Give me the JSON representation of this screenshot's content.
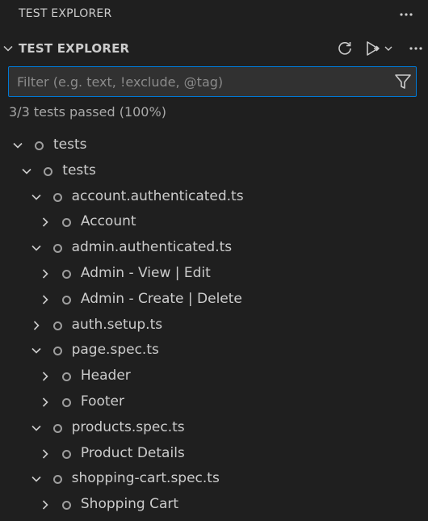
{
  "window": {
    "title": "TEST EXPLORER",
    "more_icon": "ellipsis-icon"
  },
  "section": {
    "label": "TEST EXPLORER",
    "collapse_icon": "chevron-down-icon",
    "actions": [
      "refresh-icon",
      "run-tests-icon",
      "run-options-dropdown-icon",
      "ellipsis-icon"
    ]
  },
  "filter": {
    "placeholder": "Filter (e.g. text, !exclude, @tag)",
    "value": "",
    "icon": "filter-icon"
  },
  "summary": "3/3 tests passed (100%)",
  "tree": [
    {
      "label": "tests",
      "level": 0,
      "expanded": true
    },
    {
      "label": "tests",
      "level": 1,
      "expanded": true
    },
    {
      "label": "account.authenticated.ts",
      "level": 2,
      "expanded": true
    },
    {
      "label": "Account",
      "level": 3,
      "expanded": false
    },
    {
      "label": "admin.authenticated.ts",
      "level": 2,
      "expanded": true
    },
    {
      "label": "Admin - View | Edit",
      "level": 3,
      "expanded": false
    },
    {
      "label": "Admin - Create | Delete",
      "level": 3,
      "expanded": false
    },
    {
      "label": "auth.setup.ts",
      "level": 2,
      "expanded": false
    },
    {
      "label": "page.spec.ts",
      "level": 2,
      "expanded": true
    },
    {
      "label": "Header",
      "level": 3,
      "expanded": false
    },
    {
      "label": "Footer",
      "level": 3,
      "expanded": false
    },
    {
      "label": "products.spec.ts",
      "level": 2,
      "expanded": true
    },
    {
      "label": "Product Details",
      "level": 3,
      "expanded": false
    },
    {
      "label": "shopping-cart.spec.ts",
      "level": 2,
      "expanded": true
    },
    {
      "label": "Shopping Cart",
      "level": 3,
      "expanded": false
    }
  ],
  "colors": {
    "background": "#1f1f1f",
    "focus_border": "#0078d4",
    "text": "#cccccc",
    "status_not_run": "#9d9d9d"
  }
}
